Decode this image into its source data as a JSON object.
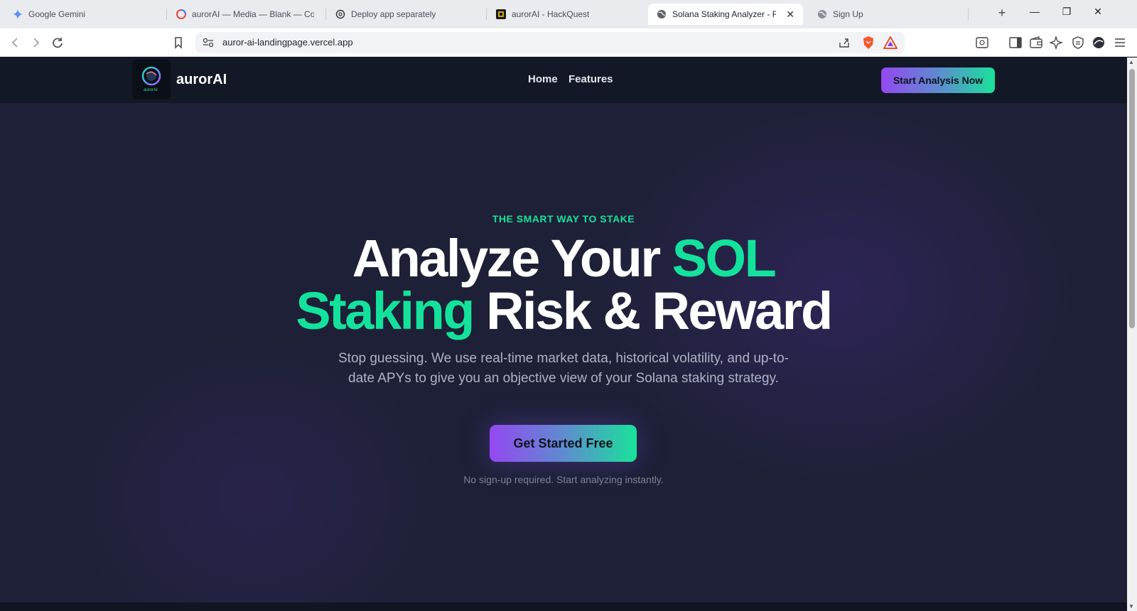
{
  "browser": {
    "tabs": [
      {
        "label": "Google Gemini",
        "icon": "gemini-icon",
        "active": false
      },
      {
        "label": "aurorAI — Media — Blank — Cont",
        "icon": "canva-icon",
        "active": false
      },
      {
        "label": "Deploy app separately",
        "icon": "openai-icon",
        "active": false
      },
      {
        "label": "aurorAI - HackQuest",
        "icon": "hackquest-icon",
        "active": false
      },
      {
        "label": "Solana Staking Analyzer - Risk",
        "icon": "globe-icon",
        "active": true
      },
      {
        "label": "Sign Up",
        "icon": "globe-icon",
        "active": false
      }
    ],
    "url": "auror-ai-landingpage.vercel.app"
  },
  "site": {
    "brand": "aurorAI",
    "logo_text": "aurorAI",
    "nav": {
      "home": "Home",
      "features": "Features"
    },
    "cta_top": "Start Analysis Now"
  },
  "hero": {
    "eyebrow": "THE SMART WAY TO STAKE",
    "headline": {
      "part1": "Analyze Your ",
      "highlight1": "SOL",
      "highlight2": "Staking",
      "part2": " Risk & Reward"
    },
    "subtext": "Stop guessing. We use real-time market data, historical volatility, and up-to-date APYs to give you an objective view of your Solana staking strategy.",
    "cta": "Get Started Free",
    "note": "No sign-up required. Start analyzing instantly."
  },
  "colors": {
    "accent_green": "#14e29c",
    "accent_purple": "#9448f2",
    "page_bg": "#1d2036",
    "nav_bg": "#121826"
  }
}
